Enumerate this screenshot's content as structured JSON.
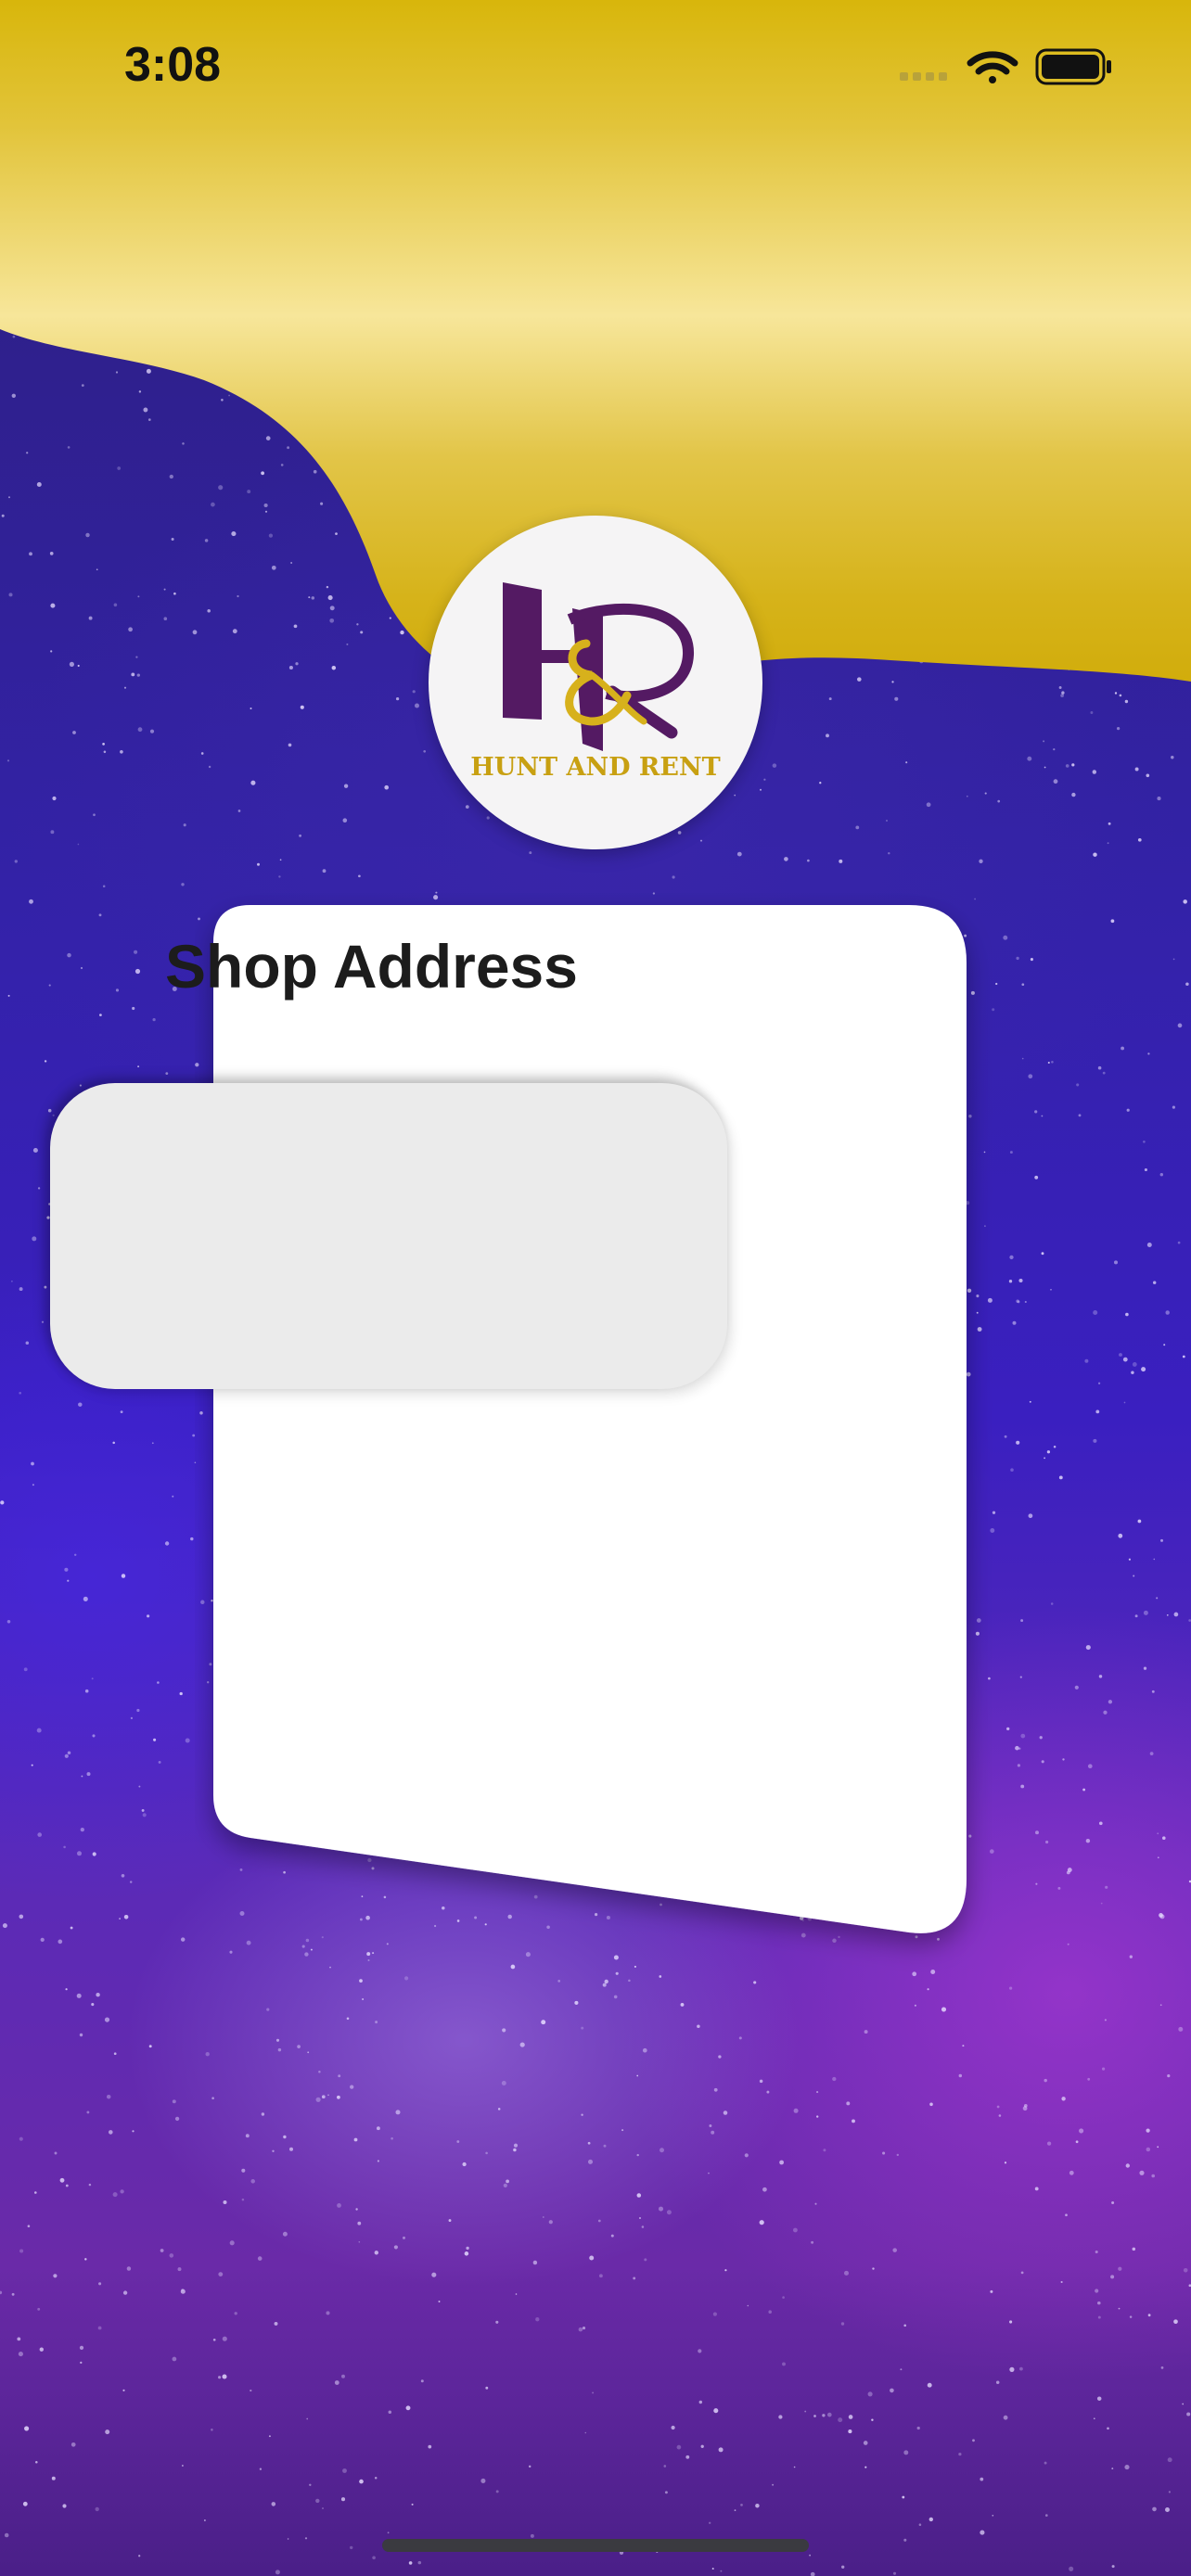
{
  "status_bar": {
    "time": "3:08",
    "icons": [
      "cellular-signal-icon",
      "wifi-icon",
      "battery-icon"
    ]
  },
  "logo": {
    "tagline": "HUNT AND RENT",
    "monogram": "H&R"
  },
  "form": {
    "title": "Shop Address",
    "address_input": {
      "value": "",
      "placeholder": ""
    }
  },
  "colors": {
    "gold": "#d9b70e",
    "purple": "#5a1f6e",
    "card": "#ffffff",
    "input": "#ebebeb"
  }
}
